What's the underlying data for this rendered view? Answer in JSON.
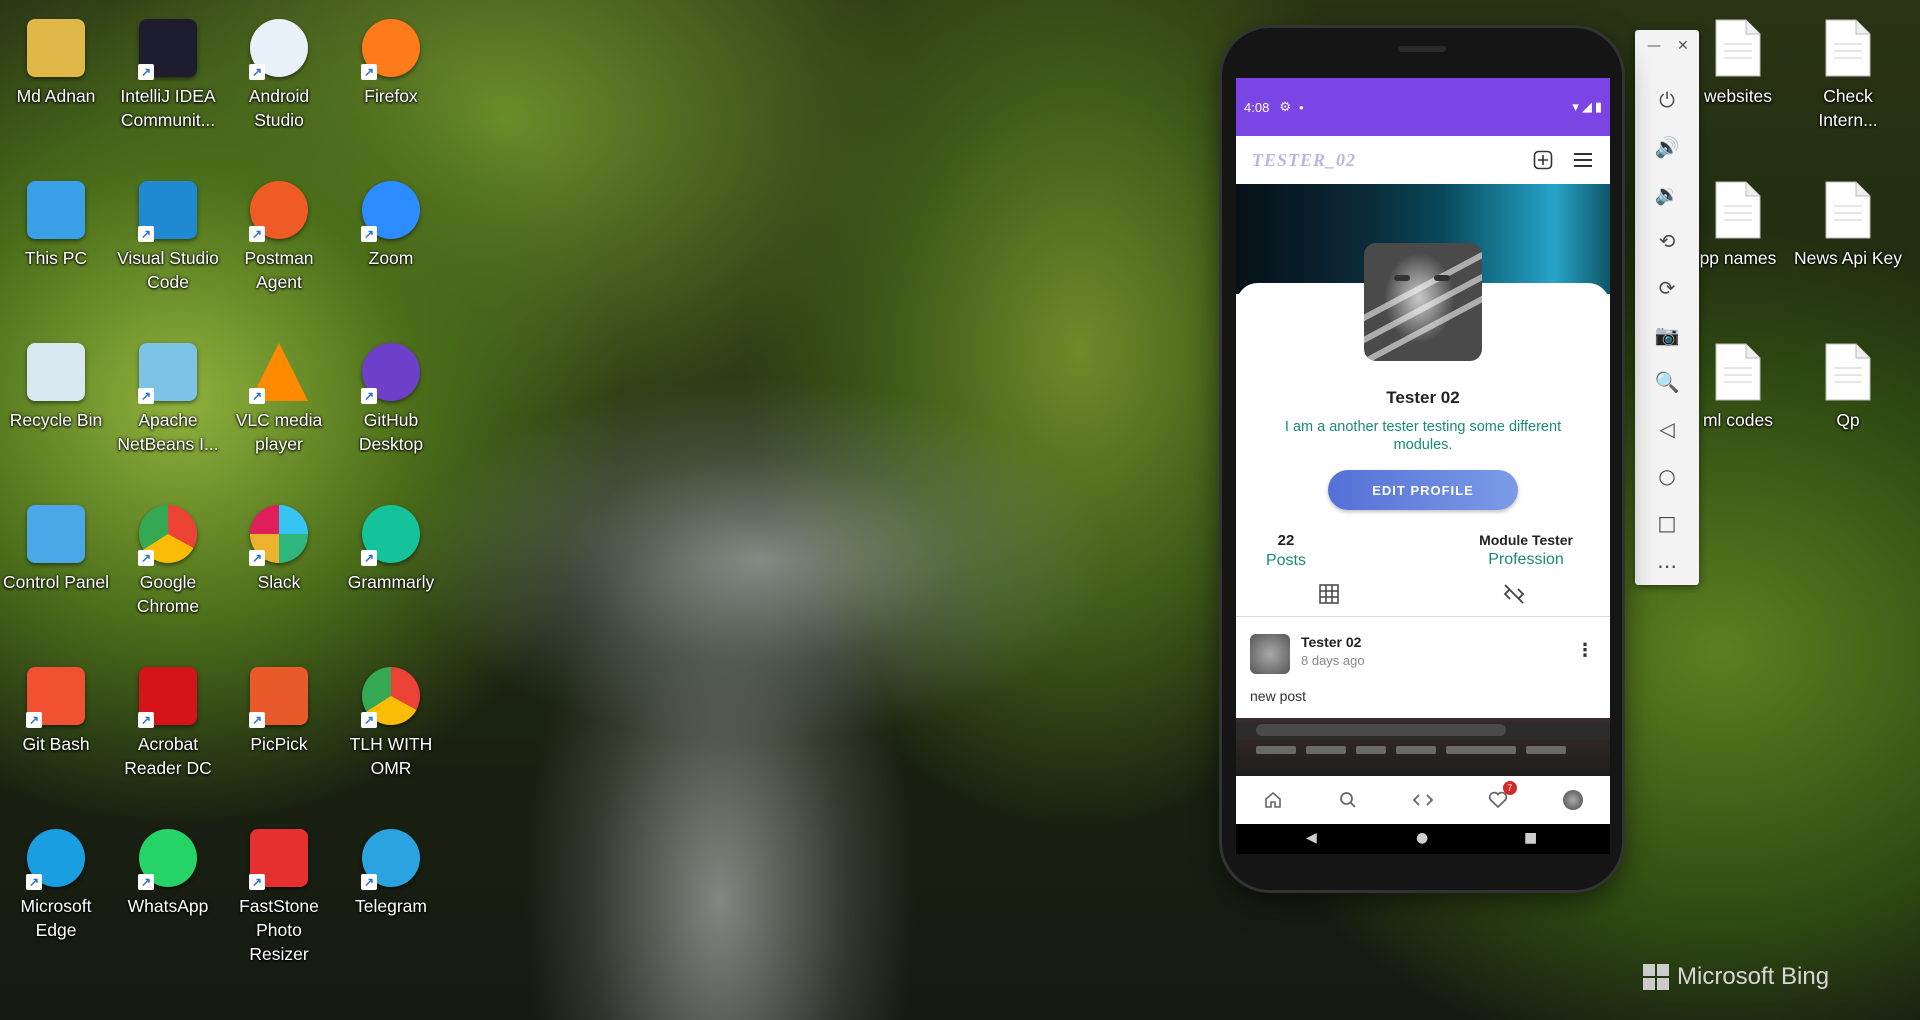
{
  "desktop": {
    "icons": [
      {
        "label": "Md Adnan",
        "glyph": "user-folder-icon"
      },
      {
        "label": "IntelliJ IDEA Communit...",
        "glyph": "intellij-icon"
      },
      {
        "label": "Android Studio",
        "glyph": "android-studio-icon"
      },
      {
        "label": "Firefox",
        "glyph": "firefox-icon"
      },
      {
        "label": "This PC",
        "glyph": "this-pc-icon"
      },
      {
        "label": "Visual Studio Code",
        "glyph": "vscode-icon"
      },
      {
        "label": "Postman Agent",
        "glyph": "postman-icon"
      },
      {
        "label": "Zoom",
        "glyph": "zoom-icon"
      },
      {
        "label": "Recycle Bin",
        "glyph": "recycle-bin-icon"
      },
      {
        "label": "Apache NetBeans I...",
        "glyph": "netbeans-icon"
      },
      {
        "label": "VLC media player",
        "glyph": "vlc-icon"
      },
      {
        "label": "GitHub Desktop",
        "glyph": "github-desktop-icon"
      },
      {
        "label": "Control Panel",
        "glyph": "control-panel-icon"
      },
      {
        "label": "Google Chrome",
        "glyph": "chrome-icon"
      },
      {
        "label": "Slack",
        "glyph": "slack-icon"
      },
      {
        "label": "Grammarly",
        "glyph": "grammarly-icon"
      },
      {
        "label": "Git Bash",
        "glyph": "git-bash-icon"
      },
      {
        "label": "Acrobat Reader DC",
        "glyph": "acrobat-icon"
      },
      {
        "label": "PicPick",
        "glyph": "picpick-icon"
      },
      {
        "label": "TLH WITH OMR",
        "glyph": "chrome-icon"
      },
      {
        "label": "Microsoft Edge",
        "glyph": "edge-icon"
      },
      {
        "label": "WhatsApp",
        "glyph": "whatsapp-icon"
      },
      {
        "label": "FastStone Photo Resizer",
        "glyph": "faststone-icon"
      },
      {
        "label": "Telegram",
        "glyph": "telegram-icon"
      }
    ],
    "right_icons": [
      {
        "label": "websites"
      },
      {
        "label": "Check Intern..."
      },
      {
        "label": "pp names"
      },
      {
        "label": "News Api Key"
      },
      {
        "label": "ml codes"
      },
      {
        "label": "Qp"
      }
    ],
    "bing_label": "Microsoft Bing"
  },
  "phone": {
    "status_time": "4:08",
    "app_title": "TESTER_02",
    "profile": {
      "name": "Tester 02",
      "bio": "I am a another tester testing some different modules.",
      "edit_button": "EDIT PROFILE",
      "posts_count": "22",
      "posts_label": "Posts",
      "profession_value": "Module Tester",
      "profession_label": "Profession"
    },
    "post": {
      "author": "Tester 02",
      "time": "8 days ago",
      "caption": "new post"
    },
    "nav_badge": "7"
  },
  "colors": {
    "status_bar": "#7b44e4",
    "accent_teal": "#1a8a78",
    "button": "#6a86de"
  }
}
